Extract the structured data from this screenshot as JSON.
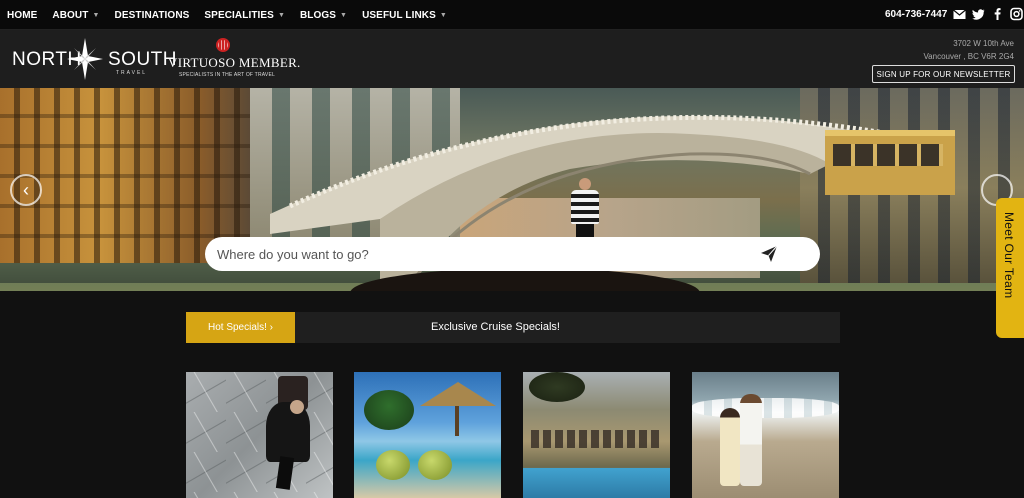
{
  "nav": {
    "items": [
      {
        "label": "HOME",
        "dropdown": false
      },
      {
        "label": "ABOUT",
        "dropdown": true
      },
      {
        "label": "DESTINATIONS",
        "dropdown": false
      },
      {
        "label": "SPECIALITIES",
        "dropdown": true
      },
      {
        "label": "BLOGS",
        "dropdown": true
      },
      {
        "label": "USEFUL LINKS",
        "dropdown": true
      }
    ],
    "phone": "604-736-7447",
    "social": [
      "envelope-icon",
      "twitter-icon",
      "facebook-icon",
      "instagram-icon"
    ]
  },
  "header": {
    "logo": {
      "north": "NORTH",
      "south": "SOUTH",
      "travel": "TRAVEL"
    },
    "virtuoso": {
      "name": "VIRTUOSO MEMBER.",
      "tagline": "SPECIALISTS IN THE ART OF TRAVEL"
    },
    "address": {
      "line1": "3702 W 10th Ave",
      "line2": "Vancouver , BC V6R 2G4"
    },
    "newsletter_label": "SIGN UP FOR OUR NEWSLETTER"
  },
  "hero": {
    "search_placeholder": "Where do you want to go?",
    "arrow_left": "‹"
  },
  "side_tab": {
    "label": "Meet Our Team"
  },
  "specials": {
    "hot_label": "Hot Specials! ›",
    "headline": "Exclusive Cruise Specials!"
  },
  "colors": {
    "accent": "#d6a514",
    "side_tab": "#e2b412",
    "background": "#111111"
  }
}
